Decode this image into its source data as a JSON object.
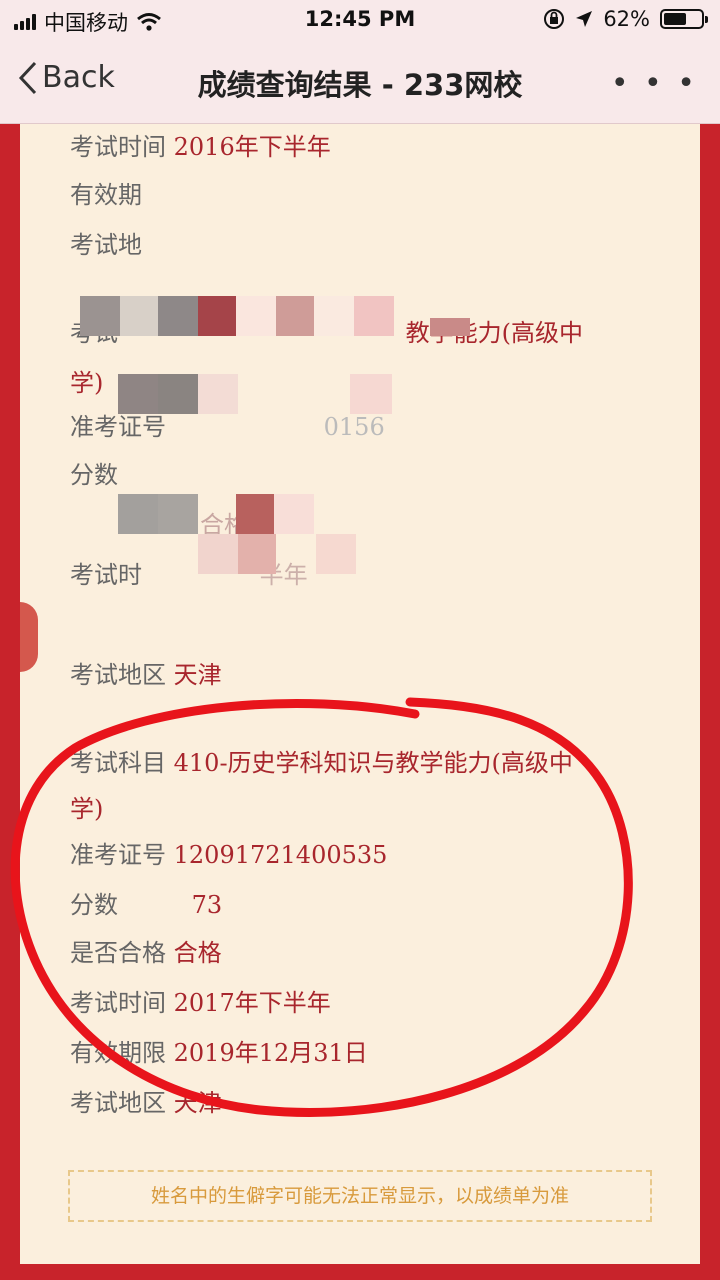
{
  "status": {
    "carrier": "中国移动",
    "time": "12:45 PM",
    "battery": "62%",
    "battery_level": 0.62
  },
  "nav": {
    "back_label": "Back",
    "title": "成绩查询结果 - 233网校",
    "more_label": "• • •"
  },
  "record_top": {
    "time_label": "考试时间",
    "time_value": "2016年下半年",
    "validity_label": "有效期",
    "region_label": "考试地",
    "subject_label": "考试",
    "subject_value": "教学能力(高级中",
    "subject_value_cont": "学)",
    "ticket_label": "准考证号",
    "ticket_value": "0156",
    "score_label": "分数",
    "pass_value": "合格",
    "time2_label": "考试时",
    "time2_value": "半年",
    "region2_label": "考试地区",
    "region2_value": "天津"
  },
  "record_main": {
    "subject_label": "考试科目",
    "subject_value": "410-历史学科知识与教学能力(高级中",
    "subject_value_cont": "学)",
    "ticket_label": "准考证号",
    "ticket_value": "12091721400535",
    "score_label": "分数",
    "score_value": "73",
    "pass_label": "是否合格",
    "pass_value": "合格",
    "time_label": "考试时间",
    "time_value": "2017年下半年",
    "validity_label": "有效期限",
    "validity_value": "2019年12月31日",
    "region_label": "考试地区",
    "region_value": "天津"
  },
  "notice": "姓名中的生僻字可能无法正常显示，以成绩单为准",
  "colors": {
    "frame": "#c8232b",
    "card": "#fbefdd",
    "value": "#a8262d",
    "annotation": "#e8141b"
  }
}
